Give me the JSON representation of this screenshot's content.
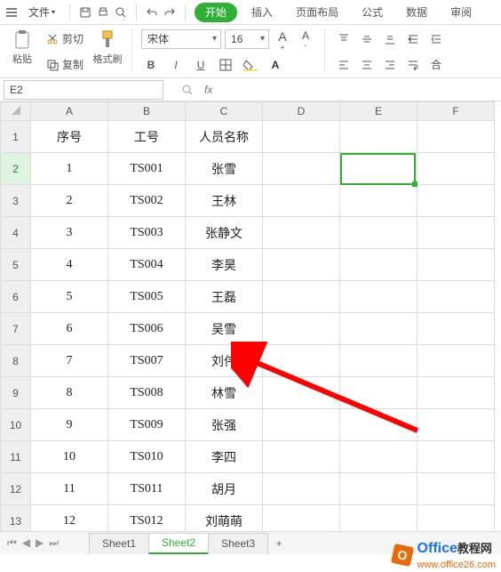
{
  "menubar": {
    "file_label": "文件",
    "tabs": [
      "开始",
      "插入",
      "页面布局",
      "公式",
      "数据",
      "审阅"
    ]
  },
  "ribbon": {
    "paste_label": "粘贴",
    "cut_label": "剪切",
    "copy_label": "复制",
    "brush_label": "格式刷",
    "font_name": "宋体",
    "font_size": "16",
    "merge_label": "合"
  },
  "formulaBar": {
    "cell_ref": "E2",
    "fx": "fx"
  },
  "columns": [
    "A",
    "B",
    "C",
    "D",
    "E",
    "F"
  ],
  "headers": {
    "A": "序号",
    "B": "工号",
    "C": "人员名称"
  },
  "rows": [
    {
      "n": "1",
      "A": "1",
      "B": "TS001",
      "C": "张雪"
    },
    {
      "n": "2",
      "A": "2",
      "B": "TS002",
      "C": "王林"
    },
    {
      "n": "3",
      "A": "3",
      "B": "TS003",
      "C": "张静文"
    },
    {
      "n": "4",
      "A": "4",
      "B": "TS004",
      "C": "李昊"
    },
    {
      "n": "5",
      "A": "5",
      "B": "TS005",
      "C": "王磊"
    },
    {
      "n": "6",
      "A": "6",
      "B": "TS006",
      "C": "吴雪"
    },
    {
      "n": "7",
      "A": "7",
      "B": "TS007",
      "C": "刘伟"
    },
    {
      "n": "8",
      "A": "8",
      "B": "TS008",
      "C": "林雪"
    },
    {
      "n": "9",
      "A": "9",
      "B": "TS009",
      "C": "张强"
    },
    {
      "n": "10",
      "A": "10",
      "B": "TS010",
      "C": "李四"
    },
    {
      "n": "11",
      "A": "11",
      "B": "TS011",
      "C": "胡月"
    },
    {
      "n": "12",
      "A": "12",
      "B": "TS012",
      "C": "刘萌萌"
    }
  ],
  "activeCell": {
    "col": "E",
    "row": 2
  },
  "sheets": {
    "tabs": [
      "Sheet1",
      "Sheet2",
      "Sheet3"
    ],
    "active": "Sheet2",
    "add": "+"
  },
  "watermark": {
    "brand": "Office",
    "suffix": "教程网",
    "url": "www.office26.com"
  }
}
